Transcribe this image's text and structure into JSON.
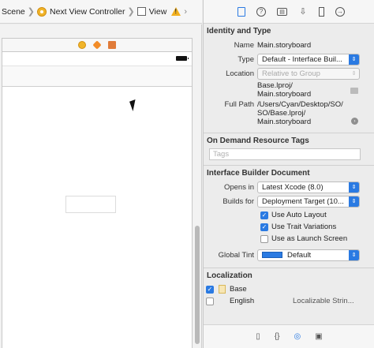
{
  "jumpbar": {
    "scene_label": "Scene",
    "vc_label": "Next View Controller",
    "view_label": "View"
  },
  "inspector": {
    "identity": {
      "title": "Identity and Type",
      "name_label": "Name",
      "name_value": "Main.storyboard",
      "type_label": "Type",
      "type_value": "Default - Interface Buil...",
      "location_label": "Location",
      "location_value": "Relative to Group",
      "base_path_1": "Base.lproj/",
      "base_path_2": "Main.storyboard",
      "fullpath_label": "Full Path",
      "fullpath_1": "/Users/Cyan/Desktop/SO/",
      "fullpath_2": "SO/Base.lproj/",
      "fullpath_3": "Main.storyboard"
    },
    "odr": {
      "title": "On Demand Resource Tags",
      "tags_placeholder": "Tags"
    },
    "ib_doc": {
      "title": "Interface Builder Document",
      "opens_in_label": "Opens in",
      "opens_in_value": "Latest Xcode (8.0)",
      "builds_for_label": "Builds for",
      "builds_for_value": "Deployment Target (10...",
      "auto_layout": "Use Auto Layout",
      "auto_layout_checked": true,
      "trait_variations": "Use Trait Variations",
      "trait_variations_checked": true,
      "launch_screen": "Use as Launch Screen",
      "launch_screen_checked": false,
      "tint_label": "Global Tint",
      "tint_value": "Default",
      "tint_color": "#2a7ae2"
    },
    "localization": {
      "title": "Localization",
      "items": [
        {
          "label": "Base",
          "checked": true,
          "extra": ""
        },
        {
          "label": "English",
          "checked": false,
          "extra": "Localizable Strin..."
        }
      ]
    }
  },
  "colors": {
    "accent": "#2a7ae2",
    "warning": "#f2b01e",
    "vc_icon": "#f0b429"
  }
}
